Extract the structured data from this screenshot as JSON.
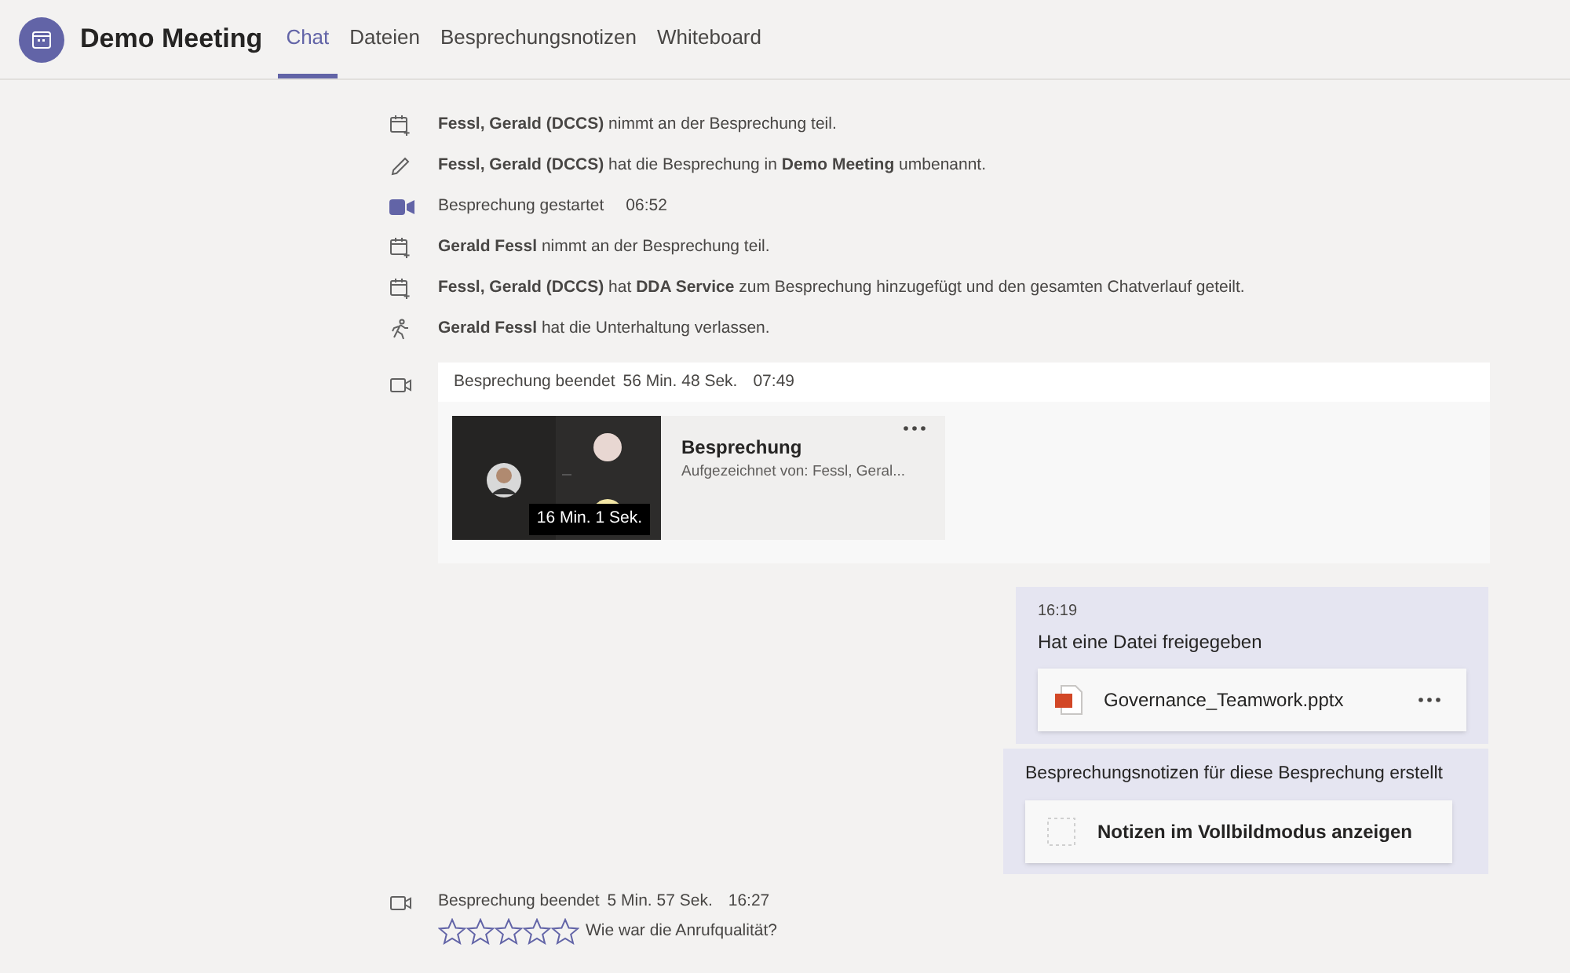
{
  "header": {
    "title": "Demo Meeting",
    "tabs": [
      {
        "label": "Chat",
        "selected": true
      },
      {
        "label": "Dateien",
        "selected": false
      },
      {
        "label": "Besprechungsnotizen",
        "selected": false
      },
      {
        "label": "Whiteboard",
        "selected": false
      }
    ]
  },
  "events": [
    {
      "kind": "join",
      "text": "**Fessl, Gerald (DCCS)** nimmt an der Besprechung teil."
    },
    {
      "kind": "rename",
      "text": "**Fessl, Gerald (DCCS)** hat die Besprechung in **Demo Meeting** umbenannt."
    },
    {
      "kind": "start",
      "text": "Besprechung gestartet",
      "time": "06:52"
    },
    {
      "kind": "join",
      "text": "**Gerald Fessl** nimmt an der Besprechung teil."
    },
    {
      "kind": "join",
      "text": "**Fessl, Gerald (DCCS)** hat **DDA Service** zum Besprechung hinzugefügt und den gesamten Chatverlauf geteilt."
    },
    {
      "kind": "leave",
      "text": "**Gerald Fessl** hat die Unterhaltung verlassen."
    }
  ],
  "meeting_ended": {
    "label": "Besprechung beendet",
    "duration": "56 Min. 48 Sek.",
    "time": "07:49",
    "recording": {
      "duration": "16 Min. 1 Sek.",
      "title": "Besprechung",
      "subtitle": "Aufgezeichnet von: Fessl, Geral..."
    }
  },
  "message": {
    "time": "16:19",
    "text": "Hat eine Datei freigegeben",
    "file": "Governance_Teamwork.pptx"
  },
  "notes": {
    "text": "Besprechungsnotizen für diese Besprechung erstellt",
    "button": "Notizen im Vollbildmodus anzeigen"
  },
  "call_ended": {
    "label": "Besprechung beendet",
    "duration": "5 Min. 57 Sek.",
    "time": "16:27",
    "stars": 0,
    "question": "Wie war die Anrufqualität?"
  }
}
